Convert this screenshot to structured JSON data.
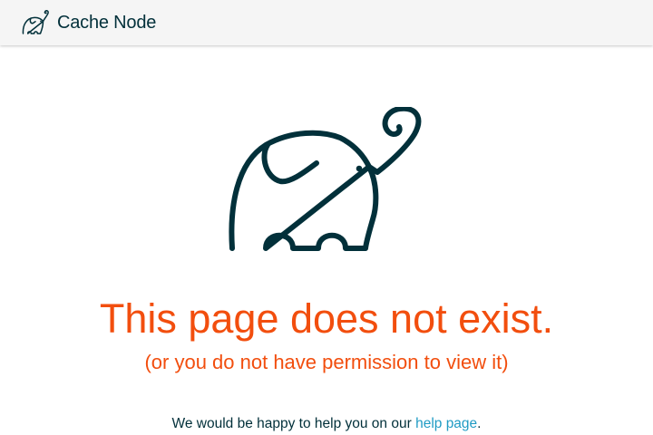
{
  "header": {
    "brand_icon": "elephant-logo-icon",
    "brand_name": "Cache Node"
  },
  "main": {
    "illustration_icon": "elephant-icon",
    "title": "This page does not exist.",
    "subtitle": "(or you do not have permission to view it)",
    "help_prefix": "We would be happy to help you on our ",
    "help_link_label": "help page",
    "help_suffix": "."
  },
  "colors": {
    "primary_text": "#02303a",
    "accent_orange": "#f24e0e",
    "link": "#209bc4",
    "header_bg": "#f5f5f5"
  }
}
